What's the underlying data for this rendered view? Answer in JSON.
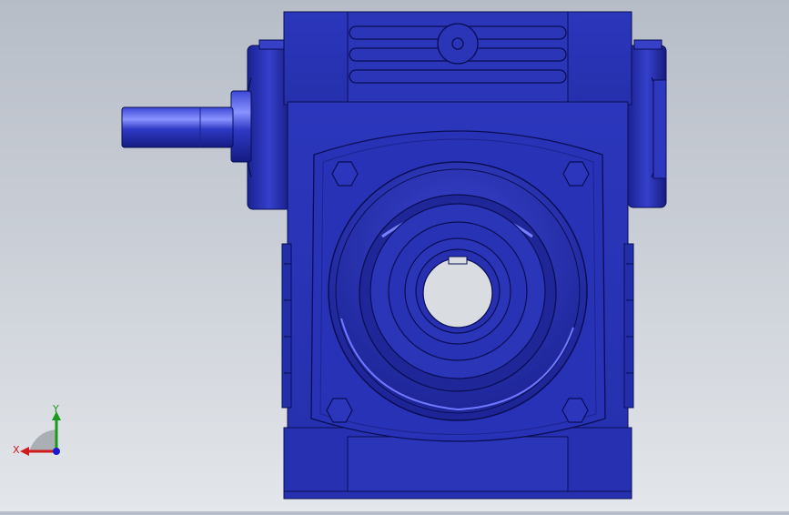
{
  "view": {
    "background_top": "#b7bdc7",
    "background_bottom": "#e3e6ea",
    "model_color": "#2a35b8",
    "model_dark": "#141a7a",
    "model_highlight": "#5a64ef"
  },
  "triad": {
    "x_label": "X",
    "y_label": "Y",
    "x_color": "#d11a1a",
    "y_color": "#1a9a1a",
    "z_color": "#1a1ad1"
  }
}
